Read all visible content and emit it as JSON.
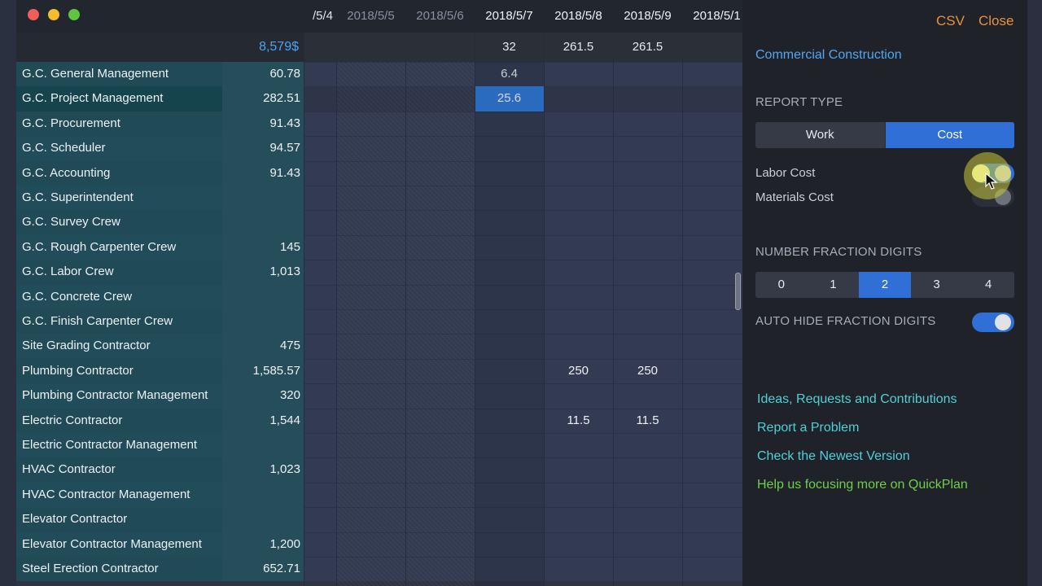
{
  "grid": {
    "total": "8,579$",
    "dates": [
      "/5/4",
      "2018/5/5",
      "2018/5/6",
      "2018/5/7",
      "2018/5/8",
      "2018/5/9",
      "2018/5/1"
    ],
    "date_totals": [
      "",
      "",
      "",
      "32",
      "261.5",
      "261.5",
      ""
    ],
    "rows": [
      {
        "name": "G.C. General Management",
        "value": "60.78",
        "cells": [
          "",
          "",
          "",
          "6.4",
          "",
          "",
          ""
        ]
      },
      {
        "name": "G.C. Project Management",
        "value": "282.51",
        "cells": [
          "",
          "",
          "",
          "25.6",
          "",
          "",
          ""
        ]
      },
      {
        "name": "G.C. Procurement",
        "value": "91.43",
        "cells": [
          "",
          "",
          "",
          "",
          "",
          "",
          ""
        ]
      },
      {
        "name": "G.C. Scheduler",
        "value": "94.57",
        "cells": [
          "",
          "",
          "",
          "",
          "",
          "",
          ""
        ]
      },
      {
        "name": "G.C. Accounting",
        "value": "91.43",
        "cells": [
          "",
          "",
          "",
          "",
          "",
          "",
          ""
        ]
      },
      {
        "name": "G.C. Superintendent",
        "value": "",
        "cells": [
          "",
          "",
          "",
          "",
          "",
          "",
          ""
        ]
      },
      {
        "name": "G.C. Survey Crew",
        "value": "",
        "cells": [
          "",
          "",
          "",
          "",
          "",
          "",
          ""
        ]
      },
      {
        "name": "G.C. Rough Carpenter Crew",
        "value": "145",
        "cells": [
          "",
          "",
          "",
          "",
          "",
          "",
          ""
        ]
      },
      {
        "name": "G.C. Labor Crew",
        "value": "1,013",
        "cells": [
          "",
          "",
          "",
          "",
          "",
          "",
          ""
        ]
      },
      {
        "name": "G.C. Concrete Crew",
        "value": "",
        "cells": [
          "",
          "",
          "",
          "",
          "",
          "",
          ""
        ]
      },
      {
        "name": "G.C. Finish Carpenter Crew",
        "value": "",
        "cells": [
          "",
          "",
          "",
          "",
          "",
          "",
          ""
        ]
      },
      {
        "name": "Site Grading Contractor",
        "value": "475",
        "cells": [
          "",
          "",
          "",
          "",
          "",
          "",
          ""
        ]
      },
      {
        "name": "Plumbing Contractor",
        "value": "1,585.57",
        "cells": [
          "",
          "",
          "",
          "",
          "250",
          "250",
          ""
        ]
      },
      {
        "name": "Plumbing Contractor Management",
        "value": "320",
        "cells": [
          "",
          "",
          "",
          "",
          "",
          "",
          ""
        ]
      },
      {
        "name": "Electric Contractor",
        "value": "1,544",
        "cells": [
          "",
          "",
          "",
          "",
          "11.5",
          "11.5",
          ""
        ]
      },
      {
        "name": "Electric Contractor Management",
        "value": "",
        "cells": [
          "",
          "",
          "",
          "",
          "",
          "",
          ""
        ]
      },
      {
        "name": "HVAC Contractor",
        "value": "1,023",
        "cells": [
          "",
          "",
          "",
          "",
          "",
          "",
          ""
        ]
      },
      {
        "name": "HVAC Contractor Management",
        "value": "",
        "cells": [
          "",
          "",
          "",
          "",
          "",
          "",
          ""
        ]
      },
      {
        "name": "Elevator Contractor",
        "value": "",
        "cells": [
          "",
          "",
          "",
          "",
          "",
          "",
          ""
        ]
      },
      {
        "name": "Elevator Contractor Management",
        "value": "1,200",
        "cells": [
          "",
          "",
          "",
          "",
          "",
          "",
          ""
        ]
      },
      {
        "name": "Steel Erection Contractor",
        "value": "652.71",
        "cells": [
          "",
          "",
          "",
          "",
          "",
          "",
          ""
        ]
      }
    ]
  },
  "panel": {
    "csv_label": "CSV",
    "close_label": "Close",
    "project_name": "Commercial Construction",
    "report_type_label": "REPORT TYPE",
    "report_types": [
      "Work",
      "Cost"
    ],
    "report_type_selected": "Cost",
    "labor_cost_label": "Labor Cost",
    "materials_cost_label": "Materials Cost",
    "fraction_label": "NUMBER FRACTION DIGITS",
    "fraction_options": [
      "0",
      "1",
      "2",
      "3",
      "4"
    ],
    "fraction_selected": "2",
    "auto_hide_label": "AUTO HIDE FRACTION DIGITS",
    "links": {
      "ideas": "Ideas, Requests and Contributions",
      "report": "Report a Problem",
      "check": "Check the Newest Version",
      "help": "Help us focusing more on QuickPlan"
    },
    "colors": {
      "accent": "#2f6fd6",
      "orange": "#e8913a",
      "teal": "#4fd0d6",
      "green": "#6fce4a"
    }
  }
}
